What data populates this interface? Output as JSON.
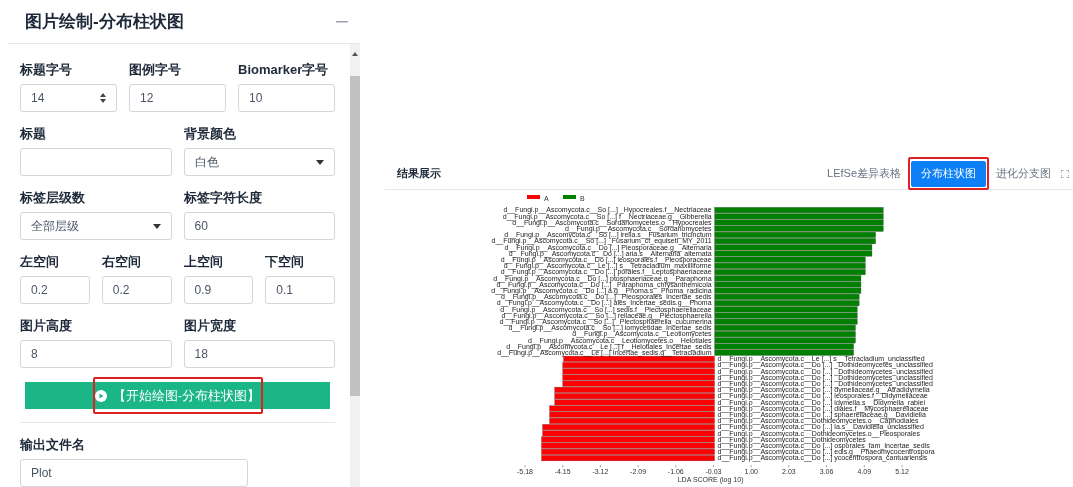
{
  "panel": {
    "title": "图片绘制-分布柱状图",
    "form_rows": [
      [
        {
          "label": "标题字号",
          "kind": "spinner",
          "value": "14"
        },
        {
          "label": "图例字号",
          "kind": "text",
          "value": "12"
        },
        {
          "label": "Biomarker字号",
          "kind": "text",
          "value": "10"
        }
      ],
      [
        {
          "label": "标题",
          "kind": "text"
        },
        {
          "label": "背景颜色",
          "kind": "select",
          "value": "白色"
        }
      ],
      [
        {
          "label": "标签层级数",
          "kind": "select",
          "value": "全部层级"
        },
        {
          "label": "标签字符长度",
          "kind": "text",
          "value": "60"
        }
      ],
      [
        {
          "label": "左空间",
          "kind": "text",
          "value": "0.2"
        },
        {
          "label": "右空间",
          "kind": "text",
          "value": "0.2"
        },
        {
          "label": "上空间",
          "kind": "text",
          "value": "0.9"
        },
        {
          "label": "下空间",
          "kind": "text",
          "value": "0.1"
        }
      ],
      [
        {
          "label": "图片高度",
          "kind": "text",
          "value": "8"
        },
        {
          "label": "图片宽度",
          "kind": "text",
          "value": "18"
        }
      ]
    ],
    "run_button": {
      "label": "【开始绘图-分布柱状图】",
      "highlighted": true
    },
    "output": {
      "label": "输出文件名",
      "value": "Plot"
    }
  },
  "results": {
    "title": "结果展示",
    "tabs": [
      {
        "label": "LEfSe差异表格",
        "selected": false,
        "highlighted": false
      },
      {
        "label": "分布柱状图",
        "selected": true,
        "highlighted": true
      },
      {
        "label": "进化分支图",
        "selected": false,
        "highlighted": false
      }
    ],
    "chart_data": {
      "type": "bar",
      "orientation": "horizontal",
      "legend": true,
      "xlabel": "LDA SCORE (log 10)",
      "xlim": [
        -5.18,
        5.12
      ],
      "xticks": [
        {
          "value": -5.18,
          "label": "-5.18"
        },
        {
          "value": -4.15,
          "label": "-4.15"
        },
        {
          "value": -3.12,
          "label": "-3.12"
        },
        {
          "value": -2.09,
          "label": "-2.09"
        },
        {
          "value": -1.06,
          "label": "-1.06"
        },
        {
          "value": -0.03,
          "label": "-0.03"
        },
        {
          "value": 1.0,
          "label": "1.00"
        },
        {
          "value": 2.03,
          "label": "2.03"
        },
        {
          "value": 3.06,
          "label": "3.06"
        },
        {
          "value": 4.09,
          "label": "4.09"
        },
        {
          "value": 5.12,
          "label": "5.12"
        }
      ],
      "categories": [
        "d__Fungi.p__Ascomycota.c__So [...] _Hypocreales.f__Nectriaceae",
        "d__Fungi.p__Ascomycota.c__So [...] f__Nectriaceae.g__Gibberella",
        "d__Fungi.p__Ascomycota.c__Sordariomycetes.o__Hypocreales",
        "d__Fungi.p__Ascomycota.c__Sordariomycetes",
        "d__Fungi.p__Ascomycota.c__So [...] irella.s__Fusarium_tricinctum",
        "d__Fungi.p__Ascomycota.c__So [...] _Fusarium_cf_equiseti_MY_2011",
        "d__Fungi.p__Ascomycota.c__Do [...] Pleosporaceae.g__Alternaria",
        "d__Fungi.p__Ascomycota.c__Do [...] aria.s__Alternaria_alternata",
        "d__Fungi.p__Ascomycota.c__Do [...] leosporales.f__Pleosporaceae",
        "d__Fungi.p__Ascomycota.c__Le [...] s__Tetracladium_maxilliforme",
        "d__Fungi.p__Ascomycota.c__Do [...] porales.f__Leptosphaeriaceae",
        "d__Fungi.p__Ascomycota.c__Do [...] ptosphaeriaceae.g__Paraphoma",
        "d__Fungi.p__Ascomycota.c__Do [...] _Paraphoma_chrysanthemicola",
        "d__Fungi.p__Ascomycota.c__Do [...] a.g__Phoma.s__Phoma_radicina",
        "d__Fungi.p__Ascomycota.c__Do [...] _Pleosporales_Incertae_sedis",
        "d__Fungi.p__Ascomycota.c__Do [...] ales_Incertae_sedis.g__Phoma",
        "d__Fungi.p__Ascomycota.c__So [...] sedis.f__Plectosphaerellaceae",
        "d__Fungi.p__Ascomycota.c__So [...] rellaceae.g__Plectosphaerella",
        "d__Fungi.p__Ascomycota.c__So [...] _Plectosphaerella_cucumerina",
        "d__Fungi.p__Ascomycota.c__So [...] iomycetidae_Incertae_sedis",
        "d__Fungi.p__Ascomycota.c__Leotiomycetes",
        "d__Fungi.p__Ascomycota.c__Leotiomycetes.o__Helotiales",
        "d__Fungi.p__Ascomycota.c__Le [...] f__Helotiales_Incertae_sedis",
        "d__Fungi.p__Ascomycota.c__Le [...] Incertae_sedis.g__Tetracladium",
        "d__Fungi.p__Ascomycota.c__Le [...] s__Tetracladium_unclassified",
        "d__Fungi.p__Ascomycota.c__Do [...] _Dothideomycetes_unclassified",
        "d__Fungi.p__Ascomycota.c__Do [...] _Dothideomycetes_unclassified",
        "d__Fungi.p__Ascomycota.c__Do [...] _Dothideomycetes_unclassified",
        "d__Fungi.p__Ascomycota.c__Do [...] _Dothideomycetes_unclassified",
        "d__Fungi.p__Ascomycota.c__Do [...] dymellaceae.g__Atradidymella",
        "d__Fungi.p__Ascomycota.c__Do [...] leosporales.f__Didymellaceae",
        "d__Fungi.p__Ascomycota.c__Do [...] idymella.s__Didymella_rabiei",
        "d__Fungi.p__Ascomycota.c__Do [...] diales.f__Mycosphaerellaceae",
        "d__Fungi.p__Ascomycota.c__Do [...] sphaerellaceae.g__Davidiella",
        "d__Fungi.p__Ascomycota.c__Dothideomycetes.o__Capnodiales",
        "d__Fungi.p__Ascomycota.c__Do [...] la.s__Davidiella_unclassified",
        "d__Fungi.p__Ascomycota.c__Dothideomycetes.o__Pleosporales",
        "d__Fungi.p__Ascomycota.c__Dothideomycetes",
        "d__Fungi.p__Ascomycota.c__Do [...] osporales_fam_Incertae_sedis",
        "d__Fungi.p__Ascomycota.c__Do [...] edis.g__Phaeomycocentrospora",
        "d__Fungi.p__Ascomycota.c__Do [...] ycocentrospora_cantuariensis"
      ],
      "series": [
        {
          "name": "A",
          "color": "#ff0000",
          "values": [
            null,
            null,
            null,
            null,
            null,
            null,
            null,
            null,
            null,
            null,
            null,
            null,
            null,
            null,
            null,
            null,
            null,
            null,
            null,
            null,
            null,
            null,
            null,
            null,
            -4.13,
            -4.15,
            -4.15,
            -4.15,
            -4.15,
            -4.37,
            -4.37,
            -4.37,
            -4.51,
            -4.51,
            -4.51,
            -4.7,
            -4.7,
            -4.73,
            -4.73,
            -4.73,
            -4.73
          ]
        },
        {
          "name": "B",
          "color": "#008000",
          "values": [
            4.61,
            4.61,
            4.61,
            4.61,
            4.4,
            4.4,
            4.3,
            4.3,
            4.12,
            4.12,
            4.12,
            4.0,
            4.0,
            4.0,
            3.95,
            3.95,
            3.9,
            3.9,
            3.9,
            3.85,
            3.85,
            3.85,
            3.8,
            3.8,
            null,
            null,
            null,
            null,
            null,
            null,
            null,
            null,
            null,
            null,
            null,
            null,
            null,
            null,
            null,
            null,
            null
          ]
        }
      ]
    }
  }
}
